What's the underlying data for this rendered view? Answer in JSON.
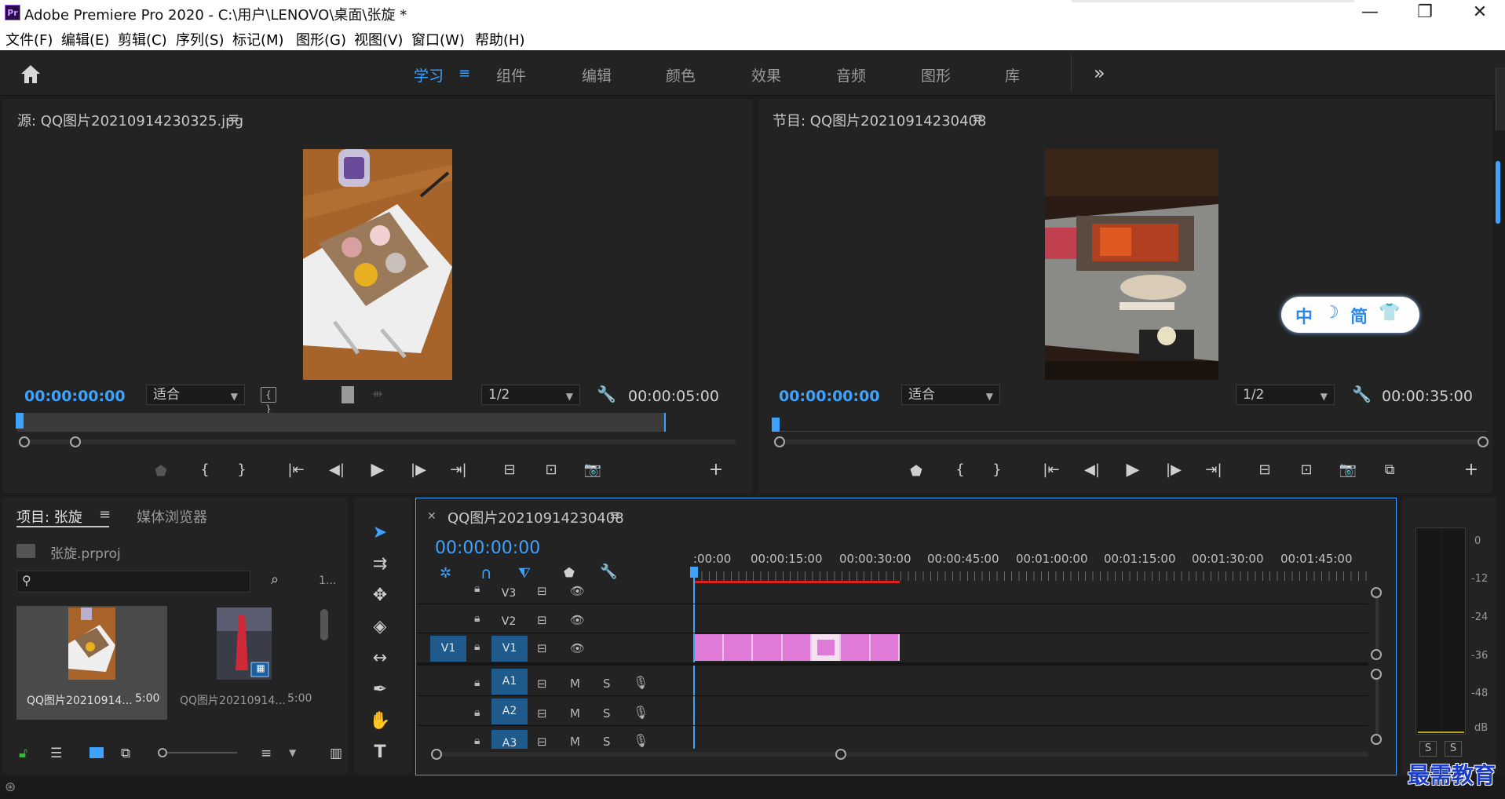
{
  "app": {
    "logo": "Pr",
    "title": "Adobe Premiere Pro 2020 - C:\\用户\\LENOVO\\桌面\\张旋 *",
    "window_controls": [
      "—",
      "❐",
      "✕"
    ]
  },
  "menu": [
    "文件(F)",
    "编辑(E)",
    "剪辑(C)",
    "序列(S)",
    "标记(M)",
    "图形(G)",
    "视图(V)",
    "窗口(W)",
    "帮助(H)"
  ],
  "workspaces": {
    "tabs": [
      "学习",
      "组件",
      "编辑",
      "颜色",
      "效果",
      "音频",
      "图形",
      "库"
    ],
    "active": "学习",
    "more": "»"
  },
  "source_monitor": {
    "title": "源: QQ图片20210914230325.jpg",
    "timecode": "00:00:00:00",
    "fit": "适合",
    "resolution": "1/2",
    "duration": "00:00:05:00"
  },
  "program_monitor": {
    "title": "节目: QQ图片20210914230408",
    "timecode": "00:00:00:00",
    "fit": "适合",
    "resolution": "1/2",
    "duration": "00:00:35:00"
  },
  "ime_widget": {
    "chars": [
      "中",
      "☽",
      "简",
      "👕"
    ]
  },
  "project": {
    "tab_active": "项目: 张旋",
    "tab_other": "媒体浏览器",
    "file": "张旋.prproj",
    "count": "1...",
    "items": [
      {
        "name": "QQ图片20210914...",
        "duration": "5:00"
      },
      {
        "name": "QQ图片20210914...",
        "duration": "5:00"
      }
    ]
  },
  "timeline": {
    "sequence": "QQ图片20210914230408",
    "timecode": "00:00:00:00",
    "ruler": [
      ":00:00",
      "00:00:15:00",
      "00:00:30:00",
      "00:00:45:00",
      "00:01:00:00",
      "00:01:15:00",
      "00:01:30:00",
      "00:01:45:00"
    ],
    "video_tracks": [
      "V3",
      "V2",
      "V1"
    ],
    "audio_tracks": [
      "A1",
      "A2",
      "A3"
    ],
    "source_patch": "V1",
    "mute": "M",
    "solo": "S"
  },
  "audio_meter": {
    "scale": [
      "0",
      "-12",
      "-24",
      "-36",
      "-48",
      "dB"
    ],
    "solo": [
      "S",
      "S"
    ]
  },
  "watermark": "最需教育",
  "colors": {
    "accent_blue": "#3ea3ff",
    "clip_pink": "#e07ad8",
    "work_area_red": "#e02020",
    "background": "#1d1d1d"
  }
}
